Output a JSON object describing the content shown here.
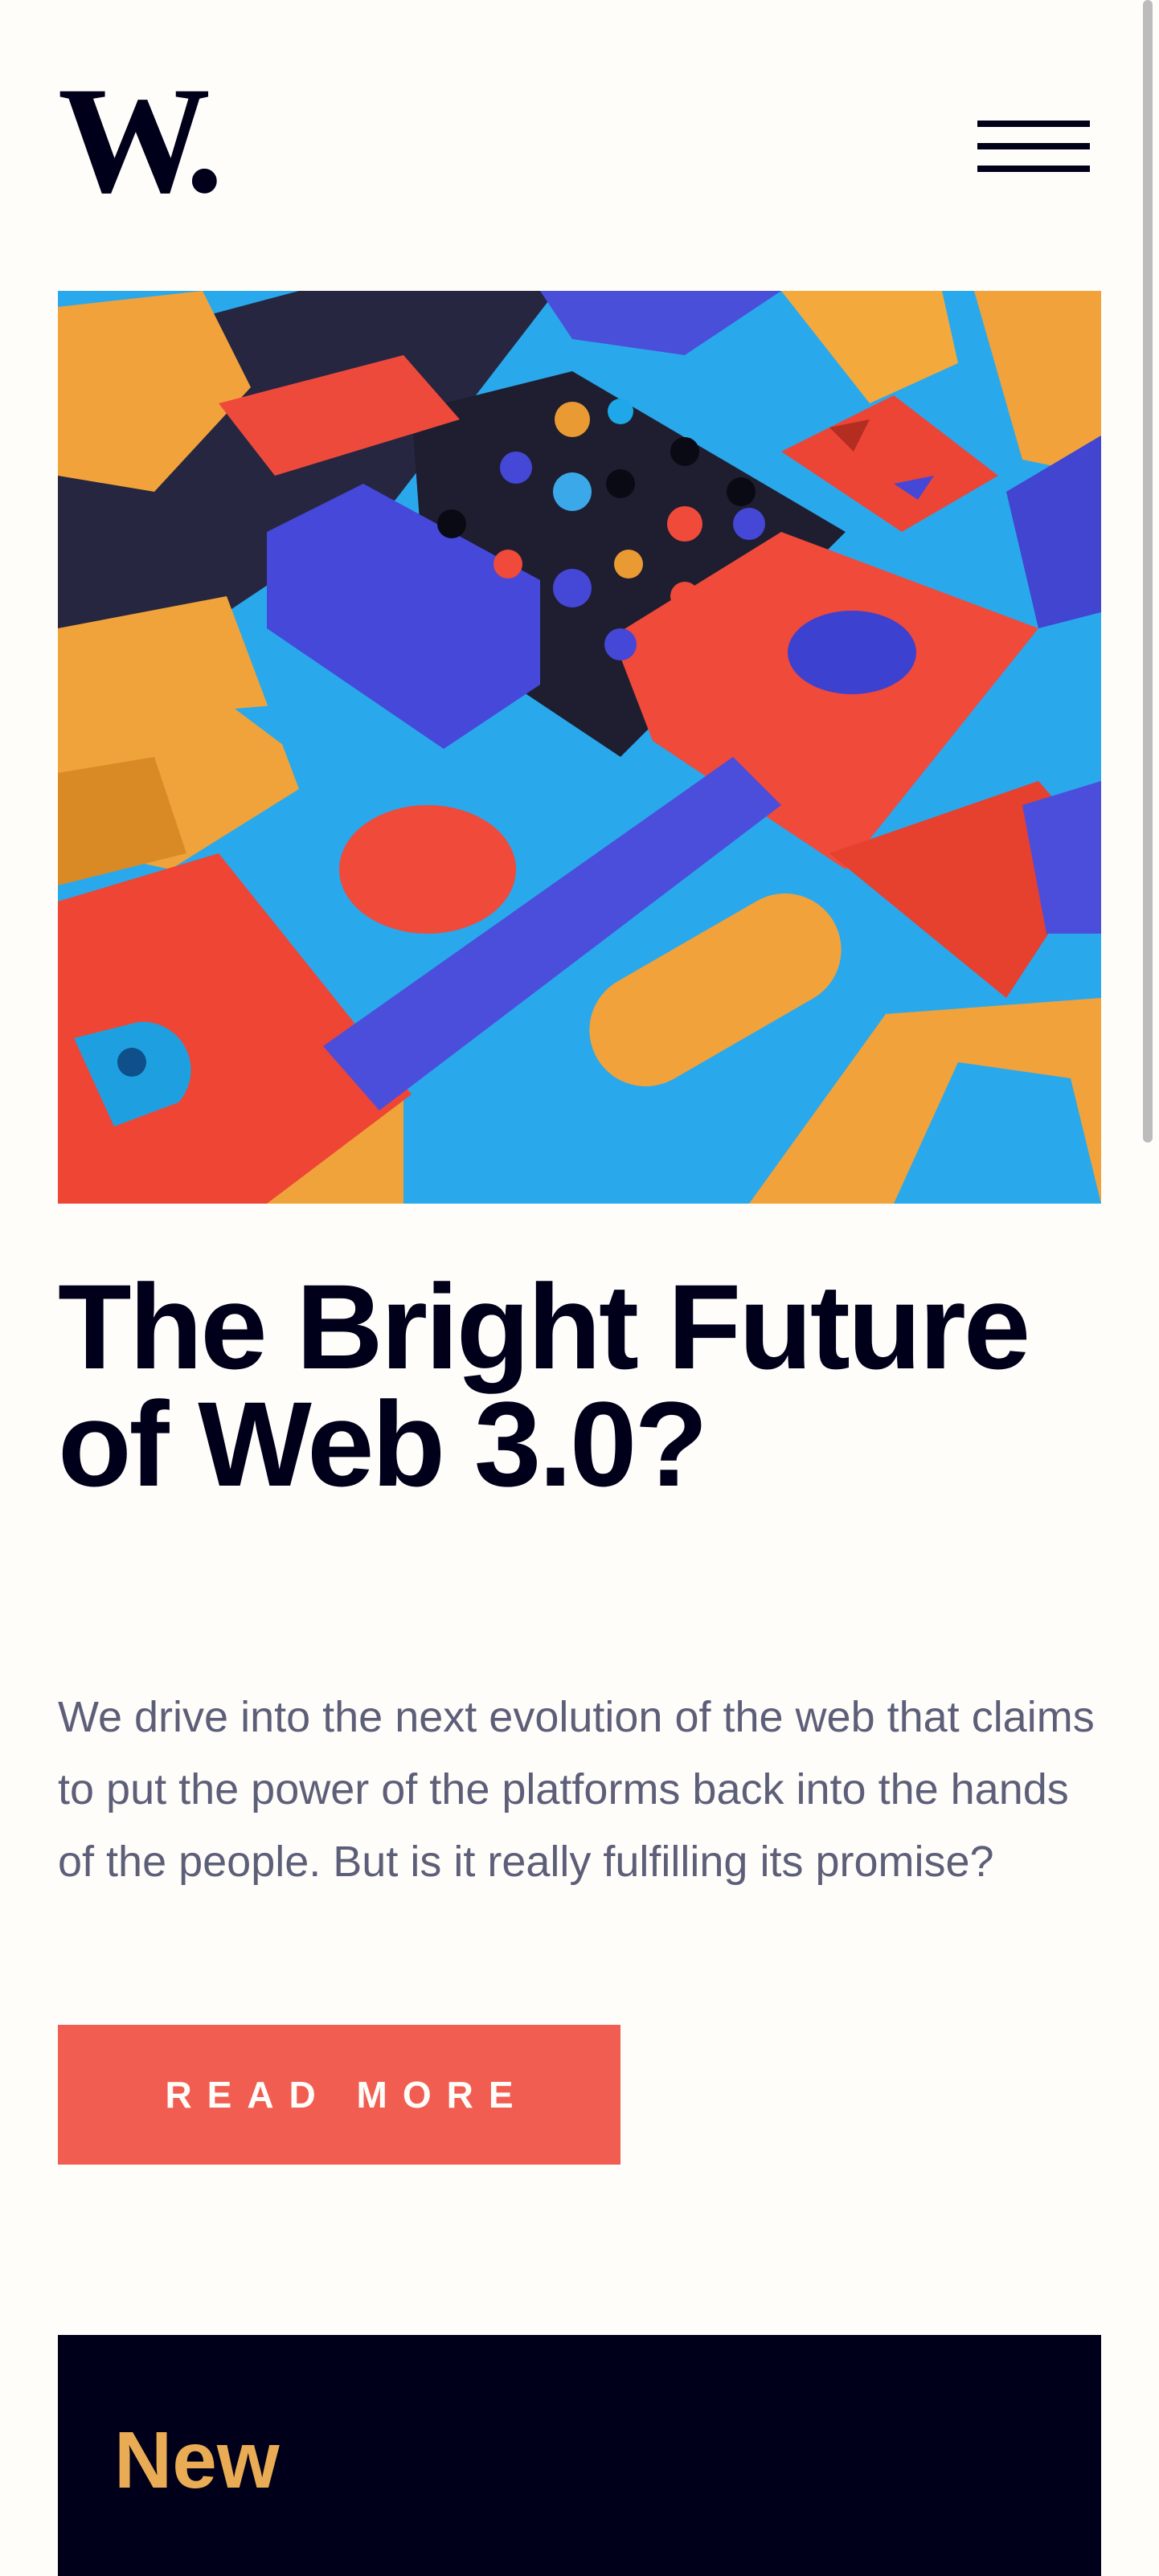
{
  "header": {
    "logo_text": "W.",
    "menu_icon": "hamburger-icon"
  },
  "hero": {
    "image_description_icon": "abstract-3d-blocks-image",
    "title": "The Bright Future of Web 3.0?",
    "intro": "We drive into the next evolution of the web that claims to put the power of the platforms back into the hands of the people. But is it really fulfilling its promise?",
    "cta_label": "READ MORE"
  },
  "new_section": {
    "title": "New"
  },
  "colors": {
    "brand_dark": "#00001a",
    "accent_red": "#f15d51",
    "accent_orange": "#e9ab53",
    "body_text": "#5d5f79",
    "background": "#fffdfa"
  }
}
